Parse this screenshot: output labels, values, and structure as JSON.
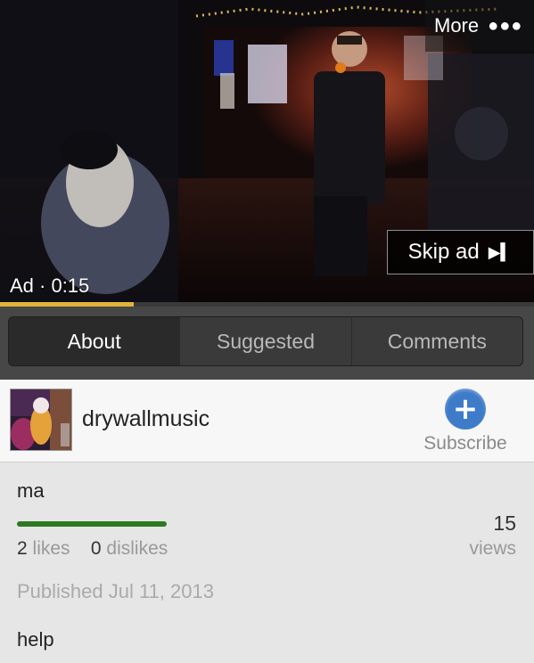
{
  "player": {
    "more_label": "More",
    "more_icon": "●●●",
    "skip_label": "Skip ad",
    "skip_icon": "▶▍",
    "ad_label": "Ad · 0:15",
    "progress_fraction": 0.25,
    "progress_color": "#e0b53a"
  },
  "tabs": [
    {
      "label": "About",
      "active": true
    },
    {
      "label": "Suggested",
      "active": false
    },
    {
      "label": "Comments",
      "active": false
    }
  ],
  "channel": {
    "name": "drywallmusic",
    "subscribe_icon": "+",
    "subscribe_label": "Subscribe",
    "subscribe_color": "#3e7bc9"
  },
  "video": {
    "title": "ma",
    "likes_count": "2",
    "likes_label": "likes",
    "dislikes_count": "0",
    "dislikes_label": "dislikes",
    "like_fraction": 1.0,
    "like_color": "#2b7a1f",
    "views_count": "15",
    "views_label": "views",
    "published": "Published Jul 11, 2013",
    "description": "help"
  }
}
